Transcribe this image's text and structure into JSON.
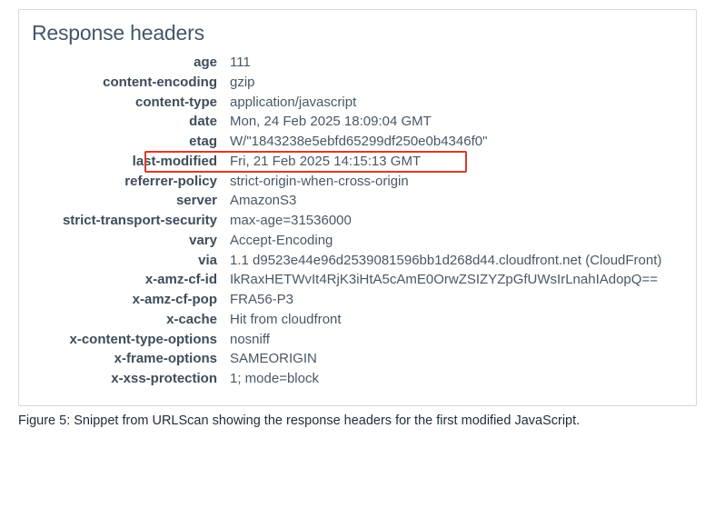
{
  "panel": {
    "title": "Response headers"
  },
  "headers": [
    {
      "name": "age",
      "value": "111",
      "highlight": false
    },
    {
      "name": "content-encoding",
      "value": "gzip",
      "highlight": false
    },
    {
      "name": "content-type",
      "value": "application/javascript",
      "highlight": false
    },
    {
      "name": "date",
      "value": "Mon, 24 Feb 2025 18:09:04 GMT",
      "highlight": false
    },
    {
      "name": "etag",
      "value": "W/\"1843238e5ebfd65299df250e0b4346f0\"",
      "highlight": false
    },
    {
      "name": "last-modified",
      "value": "Fri, 21 Feb 2025 14:15:13 GMT",
      "highlight": true
    },
    {
      "name": "referrer-policy",
      "value": "strict-origin-when-cross-origin",
      "highlight": false
    },
    {
      "name": "server",
      "value": "AmazonS3",
      "highlight": false
    },
    {
      "name": "strict-transport-security",
      "value": "max-age=31536000",
      "highlight": false
    },
    {
      "name": "vary",
      "value": "Accept-Encoding",
      "highlight": false
    },
    {
      "name": "via",
      "value": "1.1 d9523e44e96d2539081596bb1d268d44.cloudfront.net (CloudFront)",
      "highlight": false
    },
    {
      "name": "x-amz-cf-id",
      "value": "IkRaxHETWvIt4RjK3iHtA5cAmE0OrwZSIZYZpGfUWsIrLnahIAdopQ==",
      "highlight": false
    },
    {
      "name": "x-amz-cf-pop",
      "value": "FRA56-P3",
      "highlight": false
    },
    {
      "name": "x-cache",
      "value": "Hit from cloudfront",
      "highlight": false
    },
    {
      "name": "x-content-type-options",
      "value": "nosniff",
      "highlight": false
    },
    {
      "name": "x-frame-options",
      "value": "SAMEORIGIN",
      "highlight": false
    },
    {
      "name": "x-xss-protection",
      "value": "1; mode=block",
      "highlight": false
    }
  ],
  "caption": "Figure 5: Snippet from URLScan showing the response headers for the first modified JavaScript."
}
